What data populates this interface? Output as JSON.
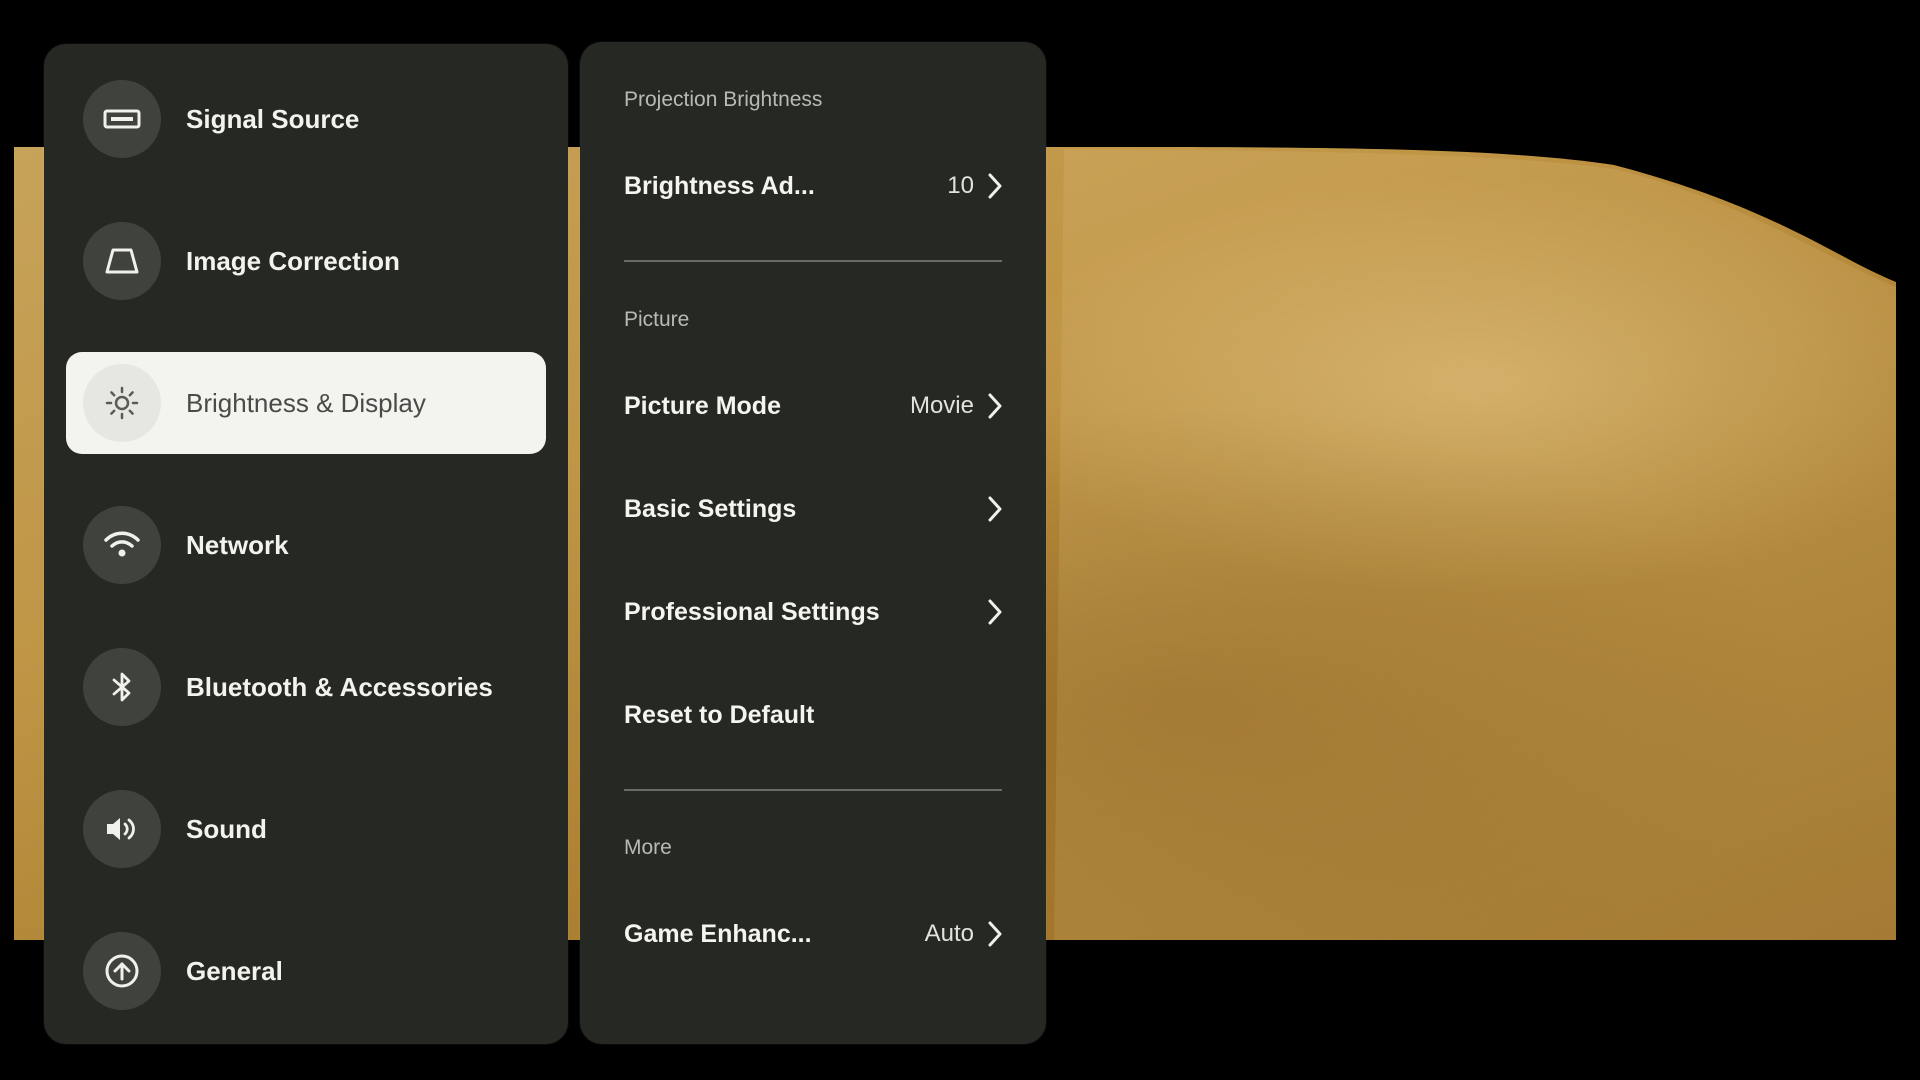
{
  "sidebar": {
    "items": [
      {
        "label": "Signal Source",
        "icon": "hdmi-port-icon",
        "active": false
      },
      {
        "label": "Image Correction",
        "icon": "keystone-trapezoid-icon",
        "active": false
      },
      {
        "label": "Brightness & Display",
        "icon": "sun-icon",
        "active": true
      },
      {
        "label": "Network",
        "icon": "wifi-icon",
        "active": false
      },
      {
        "label": "Bluetooth & Accessories",
        "icon": "bluetooth-icon",
        "active": false
      },
      {
        "label": "Sound",
        "icon": "speaker-icon",
        "active": false
      },
      {
        "label": "General",
        "icon": "upload-circle-icon",
        "active": false
      }
    ]
  },
  "detail": {
    "sections": {
      "projection_brightness": "Projection Brightness",
      "picture": "Picture",
      "more": "More"
    },
    "rows": {
      "brightness_adjustment": {
        "label": "Brightness Ad...",
        "value": "10"
      },
      "picture_mode": {
        "label": "Picture Mode",
        "value": "Movie"
      },
      "basic_settings": {
        "label": "Basic Settings"
      },
      "professional_settings": {
        "label": "Professional Settings"
      },
      "reset_to_default": {
        "label": "Reset to Default"
      },
      "game_enhancement": {
        "label": "Game Enhanc...",
        "value": "Auto"
      }
    }
  },
  "colors": {
    "panel_background": "#262824",
    "active_item_background": "#f3f4f0",
    "icon_circle": "#40423e",
    "primary_text": "#f4f4f0",
    "section_text": "#b9bab4",
    "projection_sand": "#c09546"
  }
}
